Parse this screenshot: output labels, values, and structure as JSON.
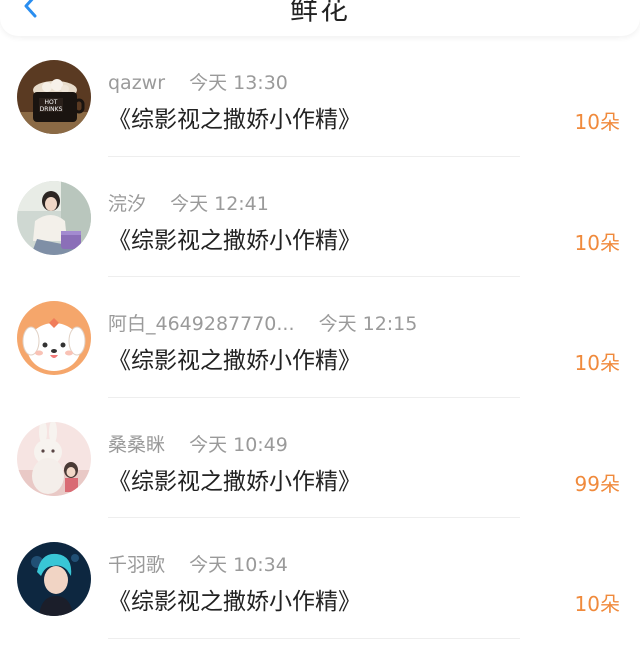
{
  "header": {
    "title": "鲜花",
    "back_icon": "chevron-left-icon",
    "accent_color": "#2a8ef0"
  },
  "colors": {
    "count": "#f08a3c",
    "name": "#9a9a9a",
    "title": "#222222"
  },
  "items": [
    {
      "name": "qazwr",
      "time": "今天 13:30",
      "title": "《综影视之撒娇小作精》",
      "count": "10朵",
      "avatar": "hot-drink-avatar"
    },
    {
      "name": "浣汐",
      "time": "今天 12:41",
      "title": "《综影视之撒娇小作精》",
      "count": "10朵",
      "avatar": "girl-photo-avatar"
    },
    {
      "name": "阿白_4649287770...",
      "time": "今天 12:15",
      "title": "《综影视之撒娇小作精》",
      "count": "10朵",
      "avatar": "cartoon-dog-avatar"
    },
    {
      "name": "桑桑眯",
      "time": "今天 10:49",
      "title": "《综影视之撒娇小作精》",
      "count": "99朵",
      "avatar": "bunny-illustration-avatar"
    },
    {
      "name": "千羽歌",
      "time": "今天 10:34",
      "title": "《综影视之撒娇小作精》",
      "count": "10朵",
      "avatar": "boy-photo-avatar"
    }
  ]
}
